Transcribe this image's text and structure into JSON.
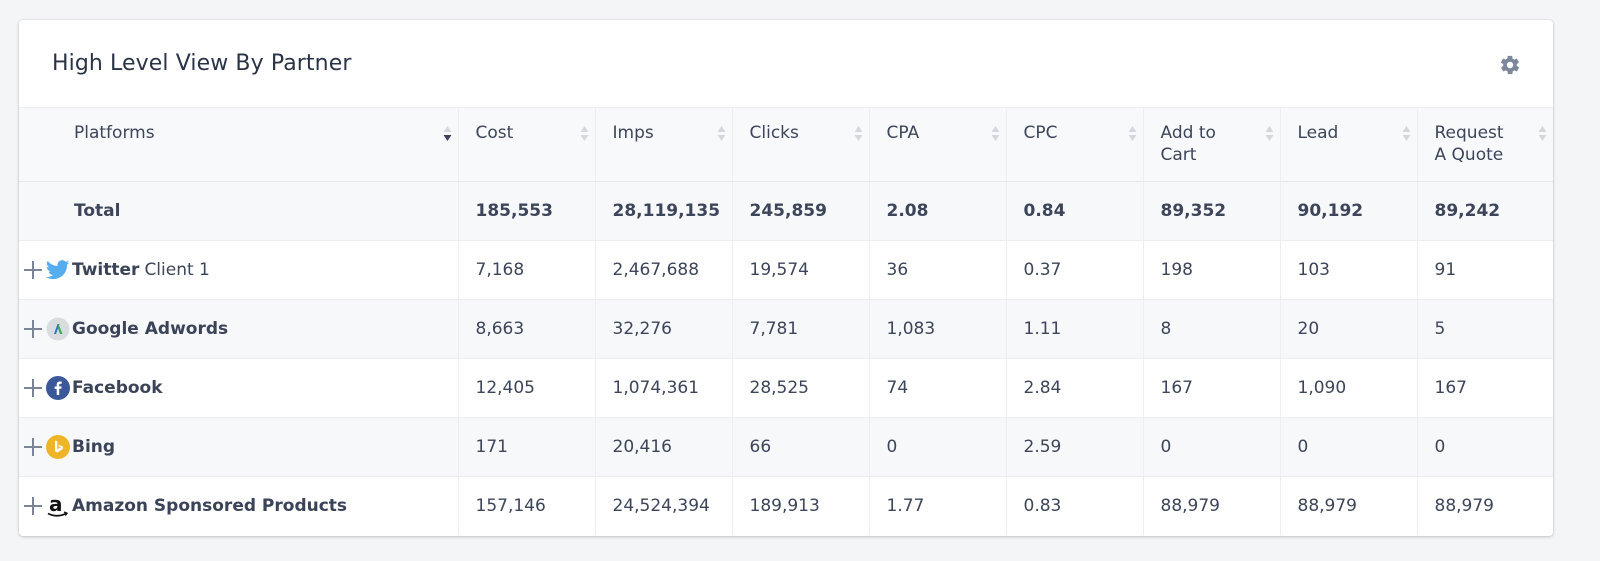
{
  "widget": {
    "title": "High Level View By Partner",
    "settings_icon": "gear-icon"
  },
  "table": {
    "columns": [
      {
        "label": "Platforms",
        "sort": "descending"
      },
      {
        "label": "Cost",
        "sort": "none"
      },
      {
        "label": "Imps",
        "sort": "none"
      },
      {
        "label": "Clicks",
        "sort": "none"
      },
      {
        "label": "CPA",
        "sort": "none"
      },
      {
        "label": "CPC",
        "sort": "none"
      },
      {
        "label": "Add to Cart",
        "sort": "none"
      },
      {
        "label": "Lead",
        "sort": "none"
      },
      {
        "label": "Request A Quote",
        "sort": "none"
      }
    ],
    "total": {
      "label": "Total",
      "values": [
        "185,553",
        "28,119,135",
        "245,859",
        "2.08",
        "0.84",
        "89,352",
        "90,192",
        "89,242"
      ]
    },
    "rows": [
      {
        "platform": "Twitter",
        "client": "Client 1",
        "icon": "twitter-icon",
        "values": [
          "7,168",
          "2,467,688",
          "19,574",
          "36",
          "0.37",
          "198",
          "103",
          "91"
        ]
      },
      {
        "platform": "Google Adwords",
        "client": "",
        "icon": "google-adwords-icon",
        "values": [
          "8,663",
          "32,276",
          "7,781",
          "1,083",
          "1.11",
          "8",
          "20",
          "5"
        ]
      },
      {
        "platform": "Facebook",
        "client": "",
        "icon": "facebook-icon",
        "values": [
          "12,405",
          "1,074,361",
          "28,525",
          "74",
          "2.84",
          "167",
          "1,090",
          "167"
        ]
      },
      {
        "platform": "Bing",
        "client": "",
        "icon": "bing-icon",
        "values": [
          "171",
          "20,416",
          "66",
          "0",
          "2.59",
          "0",
          "0",
          "0"
        ]
      },
      {
        "platform": "Amazon Sponsored Products",
        "client": "",
        "icon": "amazon-icon",
        "values": [
          "157,146",
          "24,524,394",
          "189,913",
          "1.77",
          "0.83",
          "88,979",
          "88,979",
          "88,979"
        ]
      }
    ]
  },
  "colors": {
    "twitter": "#55acee",
    "facebook": "#3b5998",
    "bing": "#f0b429",
    "adwords_blue": "#2a6fd6",
    "adwords_green": "#3aa757",
    "text": "#3c4559"
  }
}
